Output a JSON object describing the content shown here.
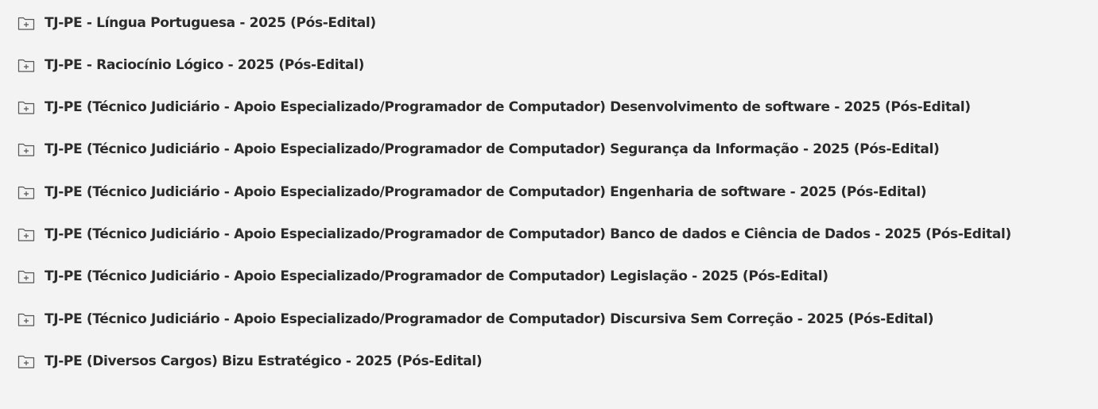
{
  "folders": [
    {
      "label": "TJ-PE - Língua Portuguesa - 2025 (Pós-Edital)",
      "icon": "folder-plus-icon"
    },
    {
      "label": "TJ-PE - Raciocínio Lógico - 2025 (Pós-Edital)",
      "icon": "folder-plus-icon"
    },
    {
      "label": "TJ-PE (Técnico Judiciário - Apoio Especializado/Programador de Computador) Desenvolvimento de software - 2025 (Pós-Edital)",
      "icon": "folder-plus-icon"
    },
    {
      "label": "TJ-PE (Técnico Judiciário - Apoio Especializado/Programador de Computador) Segurança da Informação - 2025 (Pós-Edital)",
      "icon": "folder-plus-icon"
    },
    {
      "label": "TJ-PE (Técnico Judiciário - Apoio Especializado/Programador de Computador) Engenharia de software - 2025 (Pós-Edital)",
      "icon": "folder-plus-icon"
    },
    {
      "label": "TJ-PE (Técnico Judiciário - Apoio Especializado/Programador de Computador) Banco de dados e Ciência de Dados - 2025 (Pós-Edital)",
      "icon": "folder-plus-icon"
    },
    {
      "label": "TJ-PE (Técnico Judiciário - Apoio Especializado/Programador de Computador) Legislação - 2025 (Pós-Edital)",
      "icon": "folder-plus-icon"
    },
    {
      "label": "TJ-PE (Técnico Judiciário - Apoio Especializado/Programador de Computador) Discursiva Sem Correção - 2025 (Pós-Edital)",
      "icon": "folder-plus-icon"
    },
    {
      "label": "TJ-PE (Diversos Cargos) Bizu Estratégico - 2025 (Pós-Edital)",
      "icon": "folder-plus-icon"
    }
  ]
}
